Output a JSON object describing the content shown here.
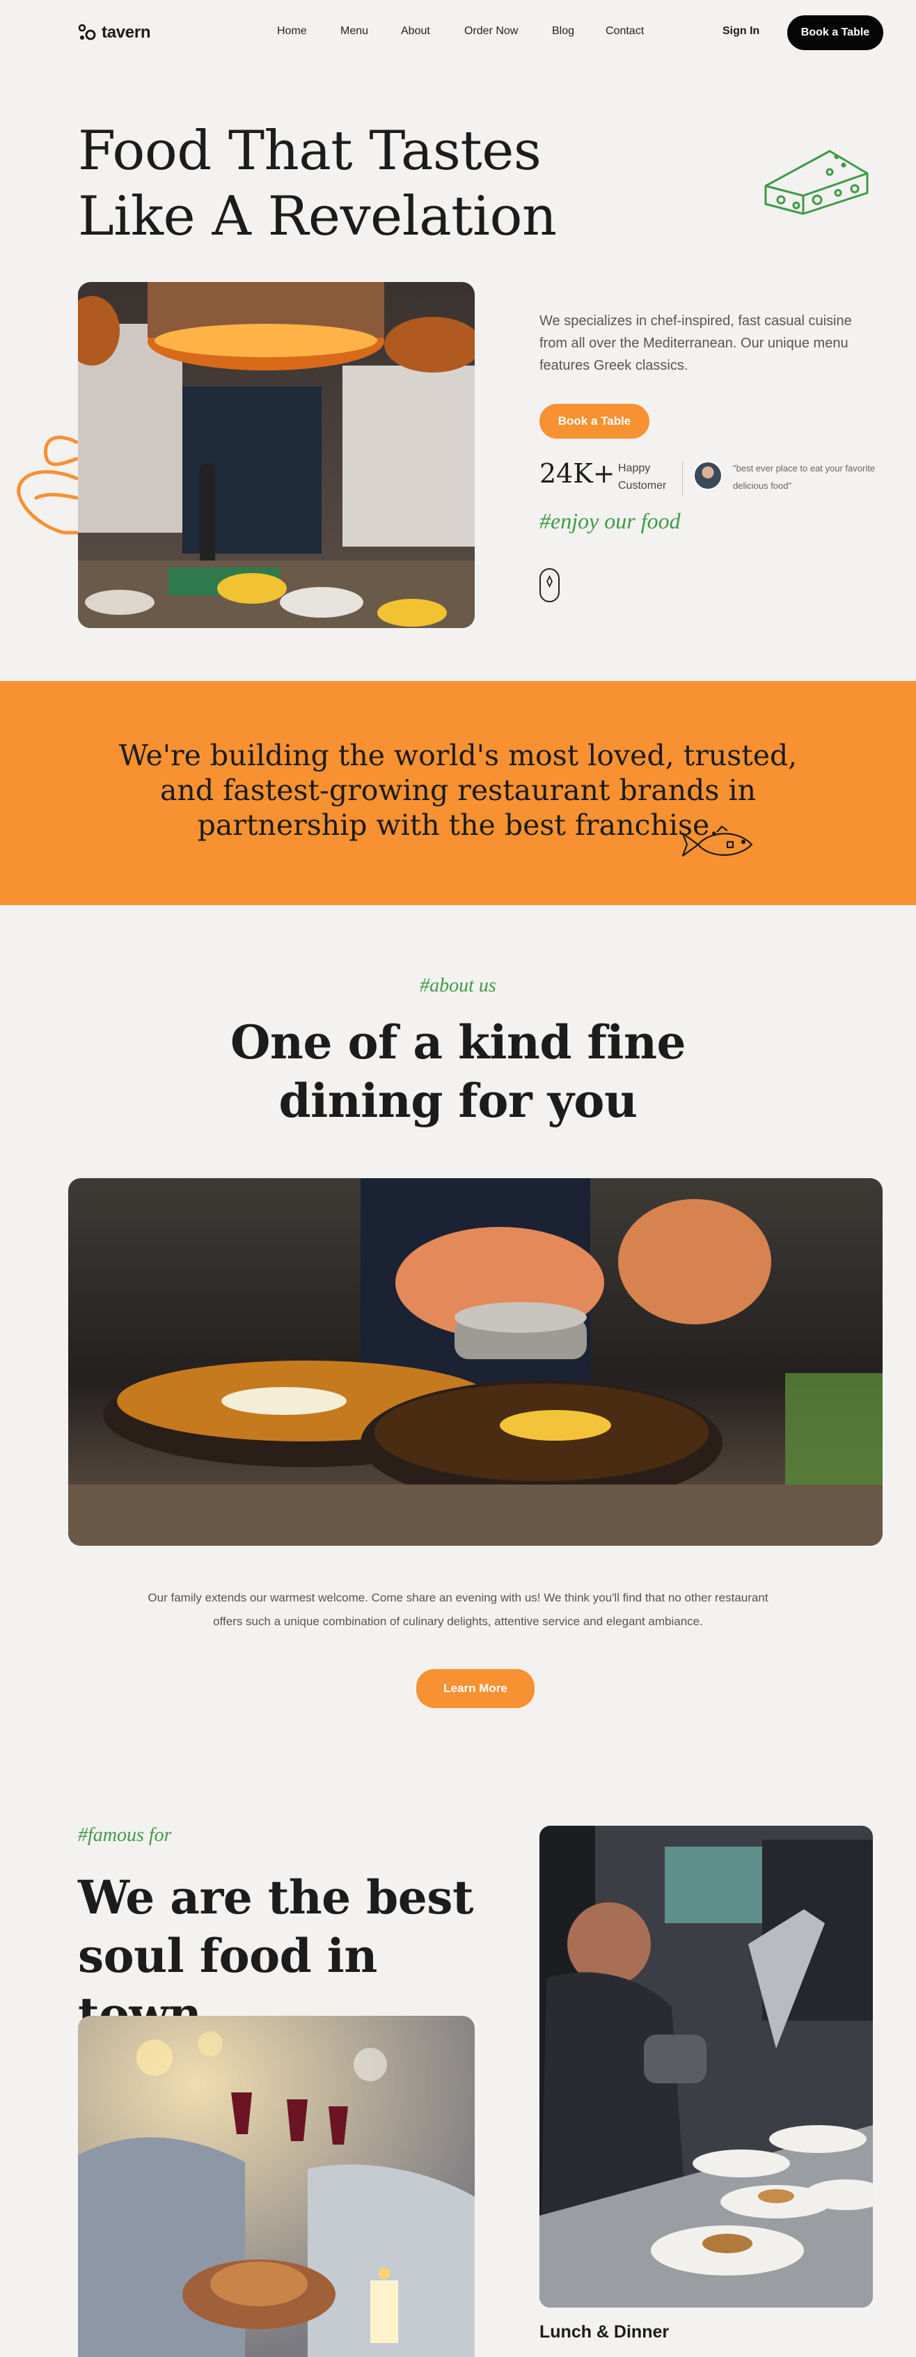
{
  "brand": {
    "name": "tavern"
  },
  "nav": {
    "links": [
      "Home",
      "Menu",
      "About",
      "Order Now",
      "Blog",
      "Contact"
    ],
    "sign_in": "Sign In",
    "book_table": "Book a Table"
  },
  "hero": {
    "title_line1": "Food That Tastes",
    "title_line2": "Like A Revelation",
    "description": "We specializes in chef-inspired, fast casual cuisine from all over the Mediterranean. Our unique menu features Greek classics.",
    "button": "Book a Table",
    "stat_value": "24K+",
    "stat_label": "Happy Customer",
    "quote": "\"best ever place to eat your favorite delicious food\"",
    "tagline": "#enjoy our food"
  },
  "banner": {
    "text": "We're building the world's most loved, trusted, and fastest-growing restaurant brands in partnership with the best franchise."
  },
  "about": {
    "tag": "#about us",
    "title_line1": "One of a kind fine",
    "title_line2": "dining for you",
    "paragraph": "Our family extends our warmest welcome. Come share an evening with us! We think you'll find that no other restaurant offers such a unique combination of culinary delights, attentive service and elegant ambiance.",
    "button": "Learn More"
  },
  "famous": {
    "tag": "#famous for",
    "title_line1": "We are the best",
    "title_line2": "soul food in town",
    "card_title": "Lunch & Dinner"
  },
  "colors": {
    "accent_orange": "#f79132",
    "script_green": "#3f9a46",
    "background": "#f3f2f0",
    "dark": "#050505"
  }
}
